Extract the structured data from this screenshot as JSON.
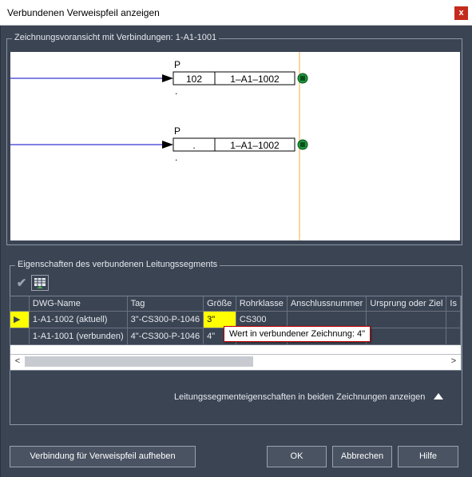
{
  "window": {
    "title": "Verbundenen Verweispfeil anzeigen",
    "close_label": "x"
  },
  "preview_group": {
    "label": "Zeichnungsvoransicht mit Verbindungen: 1-A1-1001",
    "connectors": [
      {
        "top_label": "P",
        "box_left": "102",
        "box_right": "1–A1–1002",
        "dot": "."
      },
      {
        "top_label": "P",
        "box_left": ".",
        "box_right": "1–A1–1002",
        "dot": "."
      }
    ]
  },
  "props_group": {
    "label": "Eigenschaften des verbundenen Leitungssegments",
    "toolbar": {
      "accept_icon": "checkmark-icon",
      "grid_icon": "grid-icon"
    },
    "columns": [
      "DWG-Name",
      "Tag",
      "Größe",
      "Rohrklasse",
      "Anschlussnummer",
      "Ursprung oder Ziel",
      "Is"
    ],
    "rows": [
      {
        "dwg": "1-A1-1002  (aktuell)",
        "tag": "3\"-CS300-P-1046",
        "size": "3\"",
        "class": "CS300",
        "conn": "",
        "origin": ""
      },
      {
        "dwg": "1-A1-1001  (verbunden)",
        "tag": "4\"-CS300-P-1046",
        "size": "4\"",
        "class": "",
        "conn": "",
        "origin": ""
      }
    ],
    "tooltip": "Wert in verbundener Zeichnung:  4\"",
    "show_both_link": "Leitungssegmenteigenschaften in beiden Zeichnungen anzeigen"
  },
  "buttons": {
    "unlink": "Verbindung für Verweispfeil aufheben",
    "ok": "OK",
    "cancel": "Abbrechen",
    "help": "Hilfe"
  },
  "colors": {
    "dialog_bg": "#3b4453",
    "line_blue": "#0000c8",
    "highlight": "#ffff00",
    "endpoint_green": "#1a9a3a",
    "guide_orange": "#f0b040"
  }
}
